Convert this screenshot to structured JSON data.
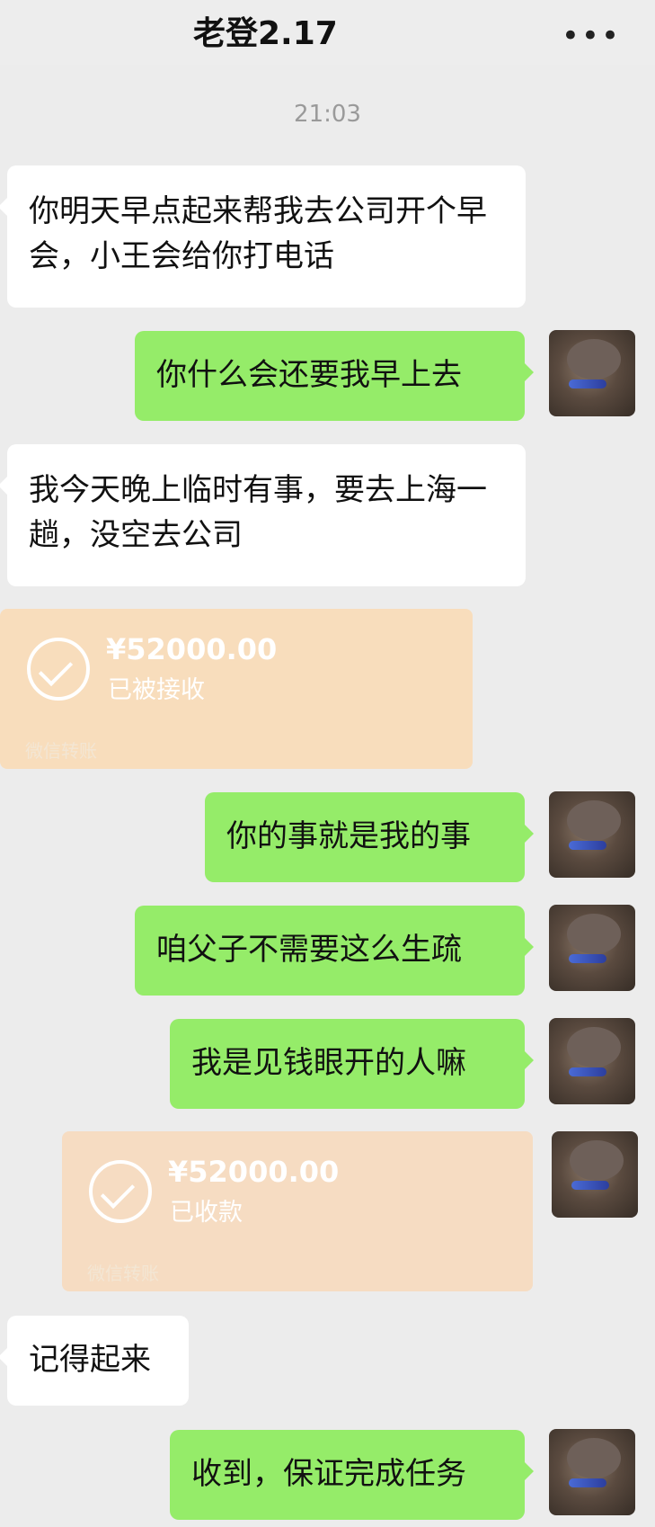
{
  "header": {
    "title": "老登2.17",
    "more_icon": "more-icon"
  },
  "timestamp": "21:03",
  "messages": [
    {
      "text": "你明天早点起来帮我去公司开个早会，小王会给你打电话"
    },
    {
      "text": "你什么会还要我早上去"
    },
    {
      "text": "我今天晚上临时有事，要去上海一趟，没空去公司"
    },
    {
      "text": "你的事就是我的事"
    },
    {
      "text": "咱父子不需要这么生疏"
    },
    {
      "text": "我是见钱眼开的人嘛"
    },
    {
      "text": "记得起来"
    },
    {
      "text": "收到，保证完成任务"
    }
  ],
  "transfers": [
    {
      "amount": "¥52000.00",
      "status": "已被接收",
      "label": "微信转账"
    },
    {
      "amount": "¥52000.00",
      "status": "已收款",
      "label": "微信转账"
    }
  ],
  "colors": {
    "sent": "#95ec69",
    "received": "#ffffff",
    "transfer": "#f8ddbc",
    "background": "#ececec"
  }
}
